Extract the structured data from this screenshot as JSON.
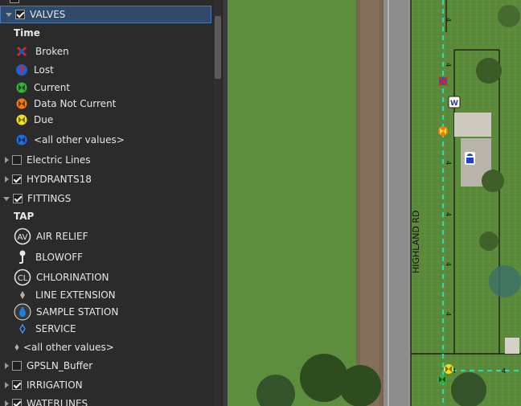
{
  "toc": {
    "layers": [
      {
        "label": "VALVES",
        "checked": true
      },
      {
        "label": "Electric Lines",
        "checked": false
      },
      {
        "label": "HYDRANTS18",
        "checked": true
      },
      {
        "label": "FITTINGS",
        "checked": true
      },
      {
        "label": "GPSLN_Buffer",
        "checked": false
      },
      {
        "label": "IRRIGATION",
        "checked": true
      },
      {
        "label": "WATERLINES",
        "checked": true
      }
    ],
    "valves_field": "Time",
    "valves_classes": [
      "Broken",
      "Lost",
      "Current",
      "Data Not Current",
      "Due",
      "<all other values>"
    ],
    "fittings_field": "TAP",
    "fittings_classes": [
      "AIR RELIEF",
      "BLOWOFF",
      "CHLORINATION",
      "LINE EXTENSION",
      "SAMPLE STATION",
      "SERVICE",
      "<all other values>"
    ],
    "symbol_text": {
      "air_relief": "AV",
      "chlorination": "CL"
    }
  },
  "map": {
    "road_label": "HIGHLAND RD",
    "pipe_size_label": "4",
    "building_marker": "W",
    "colors": {
      "broken": "#d7261e",
      "lost": "#1f5fd1",
      "current": "#3ab23a",
      "data_not_current": "#f07a1a",
      "due": "#f0e21a",
      "other": "#1f6fe0",
      "waterline": "#2fd6b0"
    }
  }
}
